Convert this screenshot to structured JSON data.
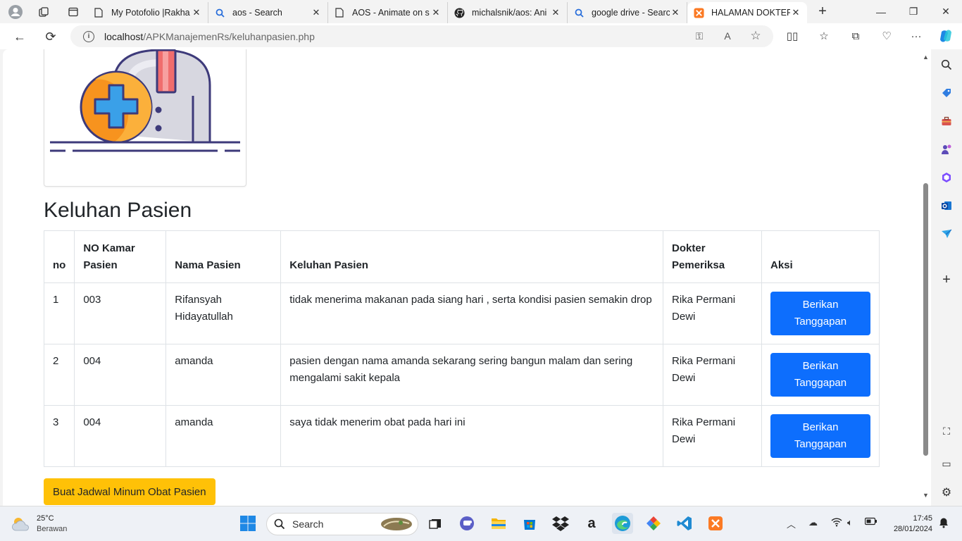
{
  "browser": {
    "tabs": [
      {
        "title": "My Potofolio |Rakha",
        "icon": "page-icon",
        "active": false
      },
      {
        "title": "aos - Search",
        "icon": "search-icon",
        "active": false
      },
      {
        "title": "AOS - Animate on s",
        "icon": "page-icon",
        "active": false
      },
      {
        "title": "michalsnik/aos: Ani",
        "icon": "github-icon",
        "active": false
      },
      {
        "title": "google drive - Searc",
        "icon": "search-icon",
        "active": false
      },
      {
        "title": "HALAMAN DOKTER",
        "icon": "xampp-icon",
        "active": true
      }
    ],
    "url_host": "localhost",
    "url_path": "/APKManajemenRs/keluhanpasien.php"
  },
  "page": {
    "heading": "Keluhan Pasien",
    "table": {
      "headers": [
        "no",
        "NO Kamar Pasien",
        "Nama Pasien",
        "Keluhan Pasien",
        "Dokter Pemeriksa",
        "Aksi"
      ],
      "rows": [
        {
          "no": "1",
          "kamar": "003",
          "nama": "Rifansyah Hidayatullah",
          "keluhan": "tidak menerima makanan pada siang hari , serta kondisi pasien semakin drop",
          "dokter": "Rika Permani Dewi",
          "aksi": "Berikan Tanggapan"
        },
        {
          "no": "2",
          "kamar": "004",
          "nama": "amanda",
          "keluhan": "pasien dengan nama amanda sekarang sering bangun malam dan sering mengalami sakit kepala",
          "dokter": "Rika Permani Dewi",
          "aksi": "Berikan Tanggapan"
        },
        {
          "no": "3",
          "kamar": "004",
          "nama": "amanda",
          "keluhan": "saya tidak menerim obat pada hari ini",
          "dokter": "Rika Permani Dewi",
          "aksi": "Berikan Tanggapan"
        }
      ]
    },
    "schedule_button": "Buat Jadwal Minum Obat Pasien"
  },
  "taskbar": {
    "weather_temp": "25°C",
    "weather_desc": "Berawan",
    "search_placeholder": "Search",
    "time": "17:45",
    "date": "28/01/2024"
  },
  "colors": {
    "primary": "#0d6efd",
    "warning": "#ffc107",
    "illustration_orange": "#f7931e",
    "illustration_blue": "#3aa0e8",
    "illustration_outline": "#3d3a7a"
  }
}
